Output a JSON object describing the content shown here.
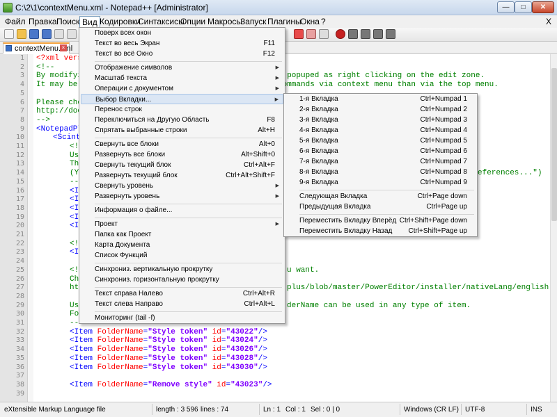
{
  "window": {
    "title": "C:\\2\\1\\contextMenu.xml - Notepad++ [Administrator]",
    "minimize": "—",
    "maximize": "□",
    "close": "✕"
  },
  "menubar": {
    "items": [
      "Файл",
      "Правка",
      "Поиск",
      "Вид",
      "Кодировки",
      "Синтаксисы",
      "Опции",
      "Макросы",
      "Запуск",
      "Плагины",
      "Окна",
      "?"
    ],
    "close": "X"
  },
  "tab": {
    "label": "contextMenu.xml",
    "close": "×"
  },
  "view_menu": {
    "items": [
      {
        "label": "Поверх всех окон",
        "shortcut": ""
      },
      {
        "label": "Текст во весь Экран",
        "shortcut": "F11"
      },
      {
        "label": "Текст во всё Окно",
        "shortcut": "F12"
      },
      {
        "label": "Отображение символов",
        "shortcut": ""
      },
      {
        "label": "Масштаб текста",
        "shortcut": ""
      },
      {
        "label": "Операции с документом",
        "shortcut": ""
      },
      {
        "label": "Выбор Вкладки...",
        "shortcut": ""
      },
      {
        "label": "Перенос строк",
        "shortcut": ""
      },
      {
        "label": "Переключиться на Другую Область",
        "shortcut": "F8"
      },
      {
        "label": "Спрятать выбранные строки",
        "shortcut": "Alt+H"
      },
      {
        "label": "Свернуть все блоки",
        "shortcut": "Alt+0"
      },
      {
        "label": "Развернуть все блоки",
        "shortcut": "Alt+Shift+0"
      },
      {
        "label": "Свернуть текущий блок",
        "shortcut": "Ctrl+Alt+F"
      },
      {
        "label": "Развернуть текущий блок",
        "shortcut": "Ctrl+Alt+Shift+F"
      },
      {
        "label": "Свернуть уровень",
        "shortcut": ""
      },
      {
        "label": "Развернуть уровень",
        "shortcut": ""
      },
      {
        "label": "Информация о файле...",
        "shortcut": ""
      },
      {
        "label": "Проект",
        "shortcut": ""
      },
      {
        "label": "Папка как Проект",
        "shortcut": ""
      },
      {
        "label": "Карта Документа",
        "shortcut": ""
      },
      {
        "label": "Список Функций",
        "shortcut": ""
      },
      {
        "label": "Синхрониз. вертикальную прокрутку",
        "shortcut": ""
      },
      {
        "label": "Синхрониз. горизонтальную прокрутку",
        "shortcut": ""
      },
      {
        "label": "Текст справа Налево",
        "shortcut": "Ctrl+Alt+R"
      },
      {
        "label": "Текст слева Направо",
        "shortcut": "Ctrl+Alt+L"
      },
      {
        "label": "Мониторинг (tail -f)",
        "shortcut": ""
      }
    ]
  },
  "tab_submenu": {
    "items": [
      {
        "label": "1-я  Вкладка",
        "shortcut": "Ctrl+Numpad 1"
      },
      {
        "label": "2-я  Вкладка",
        "shortcut": "Ctrl+Numpad 2"
      },
      {
        "label": "3-я  Вкладка",
        "shortcut": "Ctrl+Numpad 3"
      },
      {
        "label": "4-я  Вкладка",
        "shortcut": "Ctrl+Numpad 4"
      },
      {
        "label": "5-я  Вкладка",
        "shortcut": "Ctrl+Numpad 5"
      },
      {
        "label": "6-я  Вкладка",
        "shortcut": "Ctrl+Numpad 6"
      },
      {
        "label": "7-я  Вкладка",
        "shortcut": "Ctrl+Numpad 7"
      },
      {
        "label": "8-я  Вкладка",
        "shortcut": "Ctrl+Numpad 8"
      },
      {
        "label": "9-я  Вкладка",
        "shortcut": "Ctrl+Numpad 9"
      },
      {
        "label": "Следующая Вкладка",
        "shortcut": "Ctrl+Page down"
      },
      {
        "label": "Предыдущая Вкладка",
        "shortcut": "Ctrl+Page up"
      },
      {
        "label": "Переместить Вкладку Вперёд",
        "shortcut": "Ctrl+Shift+Page down"
      },
      {
        "label": "Переместить Вкладку Назад",
        "shortcut": "Ctrl+Shift+Page up"
      }
    ]
  },
  "editor": {
    "line_numbers": [
      "1",
      "2",
      "3",
      "4",
      "5",
      "6",
      "7",
      "8",
      "9",
      "10",
      "11",
      "12",
      "13",
      "14",
      "15",
      "16",
      "17",
      "18",
      "19",
      "20",
      "21",
      "22",
      "23",
      "24",
      "25",
      "26",
      "27",
      "28",
      "29",
      "30",
      "31",
      "32",
      "33",
      "34",
      "35",
      "36",
      "37",
      "38",
      "39"
    ],
    "visible_code": {
      "l1": "<?xml vers",
      "l2": "<!--",
      "l3a": "By modifyi",
      "l3b": "u popuped as right clicking on the edit zone.",
      "l4a": "It may be",
      "l4b": "commands via context menu than via the top menu.",
      "l6": "Please che",
      "l7": "http://doc",
      "l8": "-->",
      "l9": "<NotepadPl",
      "l10": "<Scint",
      "l11": "<!",
      "l12": "Us",
      "l13": "Th",
      "l14a": "(Y",
      "l14b": "eferences...\")",
      "l15": "--",
      "l16": "<I",
      "l17": "<I",
      "l18": "<I",
      "l19": "<I",
      "l20": "<I",
      "l22": "<!",
      "l23": "<I",
      "l25a": "<!",
      "l25b": "u want.",
      "l26": "Ch",
      "l27a": "ht",
      "l27b": "plus/blob/master/PowerEditor/installer/nativeLang/english.x",
      "l29a": "Us",
      "l29b": "derName can be used in any type of item.",
      "l30": "Fo",
      "l31": "-->"
    },
    "items": [
      {
        "tag": "<Item",
        "attr": "FolderName",
        "val": "\"Style token\"",
        "id": "\"43022\""
      },
      {
        "tag": "<Item",
        "attr": "FolderName",
        "val": "\"Style token\"",
        "id": "\"43024\""
      },
      {
        "tag": "<Item",
        "attr": "FolderName",
        "val": "\"Style token\"",
        "id": "\"43026\""
      },
      {
        "tag": "<Item",
        "attr": "FolderName",
        "val": "\"Style token\"",
        "id": "\"43028\""
      },
      {
        "tag": "<Item",
        "attr": "FolderName",
        "val": "\"Style token\"",
        "id": "\"43030\""
      },
      {
        "tag": "<Item",
        "attr": "FolderName",
        "val": "\"Remove style\"",
        "id": "\"43023\""
      }
    ]
  },
  "statusbar": {
    "file_type": "eXtensible Markup Language file",
    "length": "length : 3 596",
    "lines": "lines : 74",
    "ln": "Ln : 1",
    "col": "Col : 1",
    "sel": "Sel : 0 | 0",
    "eol": "Windows (CR LF)",
    "encoding": "UTF-8",
    "mode": "INS"
  },
  "colors": {
    "tag": "#0000ff",
    "attr": "#ff0000",
    "value": "#8000ff",
    "comment": "#008000",
    "menu_highlight": "#dbe6f4"
  }
}
